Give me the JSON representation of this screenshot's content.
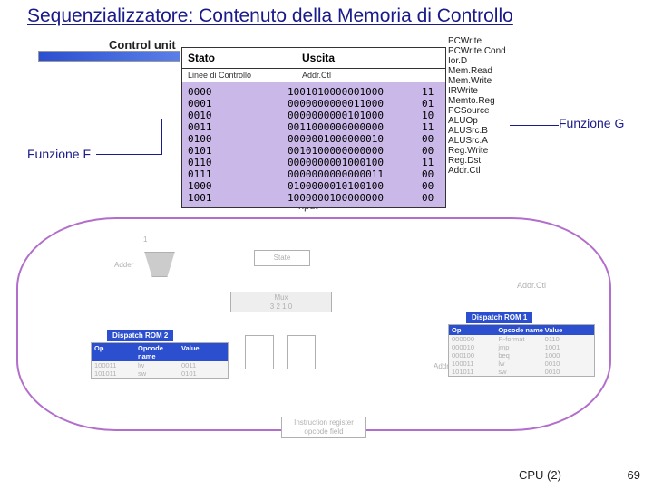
{
  "title": "Sequenzializzatore: Contenuto della Memoria di Controllo",
  "control_unit": "Control unit",
  "headers": {
    "stato": "Stato",
    "uscita": "Uscita",
    "linee": "Linee di Controllo",
    "addr": "Addr.Ctl"
  },
  "labels": {
    "funzione_f": "Funzione F",
    "funzione_g": "Funzione G",
    "input": "Input"
  },
  "signals": [
    "PCWrite",
    "PCWrite.Cond",
    "Ior.D",
    "Mem.Read",
    "Mem.Write",
    "IRWrite",
    "Memto.Reg",
    "PCSource",
    "ALUOp",
    "ALUSrc.B",
    "ALUSrc.A",
    "Reg.Write",
    "Reg.Dst",
    "Addr.Ctl"
  ],
  "rom": [
    {
      "s": "0000",
      "c": "1001010000001000",
      "a": "11"
    },
    {
      "s": "0001",
      "c": "0000000000011000",
      "a": "01"
    },
    {
      "s": "0010",
      "c": "0000000000101000",
      "a": "10"
    },
    {
      "s": "0011",
      "c": "0011000000000000",
      "a": "11"
    },
    {
      "s": "0100",
      "c": "0000001000000010",
      "a": "00"
    },
    {
      "s": "0101",
      "c": "0010100000000000",
      "a": "00"
    },
    {
      "s": "0110",
      "c": "0000000001000100",
      "a": "11"
    },
    {
      "s": "0111",
      "c": "0000000000000011",
      "a": "00"
    },
    {
      "s": "1000",
      "c": "0100000010100100",
      "a": "00"
    },
    {
      "s": "1001",
      "c": "1000000100000000",
      "a": "00"
    }
  ],
  "diagram": {
    "adder": "Adder",
    "one": "1",
    "state": "State",
    "mux": "Mux",
    "mux_nums": "3   2   1   0",
    "addrctl": "Addr.Ctl",
    "address_sel": "Address sele",
    "instruction_reg_l1": "Instruction register",
    "instruction_reg_l2": "opcode field",
    "rom2_title": "Dispatch ROM 2",
    "rom1_title": "Dispatch ROM 1",
    "tbl_hdr_op": "Op",
    "tbl_hdr_name": "Opcode name",
    "tbl_hdr_val": "Value",
    "rom2_rows": [
      {
        "op": "100011",
        "name": "lw",
        "val": "0011"
      },
      {
        "op": "101011",
        "name": "sw",
        "val": "0101"
      }
    ],
    "rom1_rows": [
      {
        "op": "000000",
        "name": "R-format",
        "val": "0110"
      },
      {
        "op": "000010",
        "name": "jmp",
        "val": "1001"
      },
      {
        "op": "000100",
        "name": "beq",
        "val": "1000"
      },
      {
        "op": "100011",
        "name": "lw",
        "val": "0010"
      },
      {
        "op": "101011",
        "name": "sw",
        "val": "0010"
      }
    ]
  },
  "footer": {
    "label": "CPU (2)",
    "page": "69"
  }
}
